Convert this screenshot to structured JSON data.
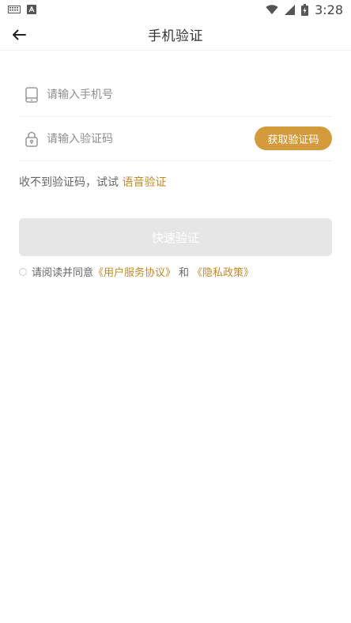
{
  "status_bar": {
    "time": "3:28"
  },
  "header": {
    "title": "手机验证"
  },
  "form": {
    "phone_placeholder": "请输入手机号",
    "code_placeholder": "请输入验证码",
    "get_code_label": "获取验证码"
  },
  "hint": {
    "text": "收不到验证码，试试",
    "link": "语音验证"
  },
  "actions": {
    "quick_verify_label": "快速验证"
  },
  "agreement": {
    "prefix": "请阅读并同意",
    "user_agreement": "《用户服务协议》",
    "and": "和",
    "privacy_policy": "《隐私政策》"
  },
  "colors": {
    "accent": "#d49b3c",
    "link": "#c08a2a",
    "disabled_button": "#e6e6e6"
  },
  "icons": {
    "back": "arrow-left-icon",
    "phone": "phone-icon",
    "lock": "lock-icon",
    "keyboard": "keyboard-icon",
    "autofill": "autofill-icon",
    "wifi": "wifi-icon",
    "signal": "signal-icon",
    "battery": "battery-icon"
  }
}
